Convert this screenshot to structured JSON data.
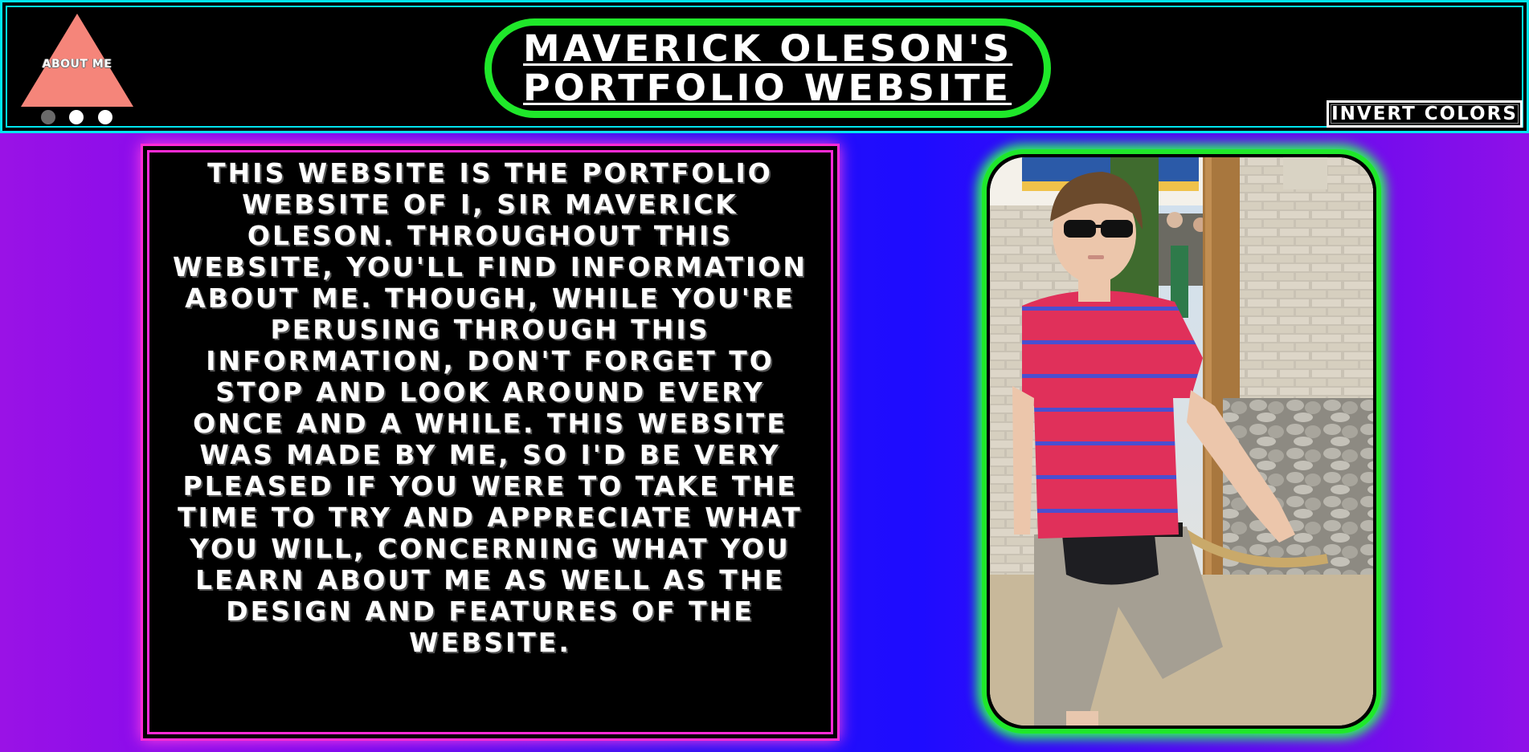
{
  "header": {
    "about_button_label": "ABOUT ME",
    "title_line_1": "MAVERICK OLESON'S",
    "title_line_2": "PORTFOLIO WEBSITE",
    "invert_button_label": "INVERT COLORS",
    "slides": {
      "count": 3,
      "active_index": 0
    }
  },
  "intro": {
    "text": "This website is the portfolio website of I, Sir Maverick Oleson. Throughout this website, you'll find information about me. Though, while you're perusing through this information, don't forget to stop and look around every once and a while. This website was made by me, so I'd be very pleased if you were to take the time to try and appreciate what you will, concerning what you learn about me as well as the design and features of the website."
  },
  "colors": {
    "header_border": "#00e5ee",
    "title_border": "#1fe82a",
    "about_triangle": "#f5857a",
    "intro_border": "#ff2bd6",
    "photo_border": "#1fe82a",
    "background_left": "#9a12e6",
    "background_center": "#1d0cff"
  },
  "icons": {
    "about_button": "triangle-icon",
    "slide_dots": "dot-indicator-icon"
  }
}
